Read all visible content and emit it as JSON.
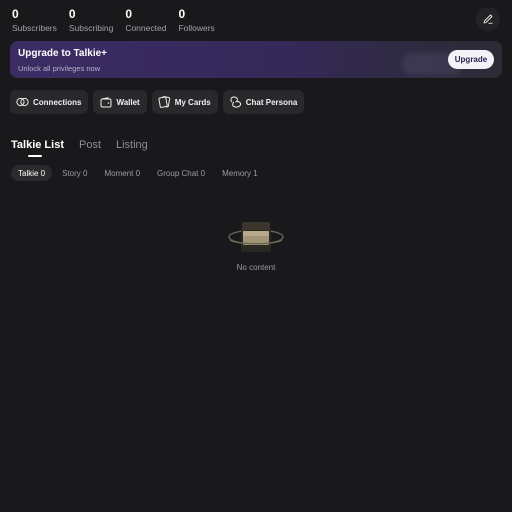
{
  "stats": [
    {
      "value": "0",
      "label": "Subscribers"
    },
    {
      "value": "0",
      "label": "Subscribing"
    },
    {
      "value": "0",
      "label": "Connected"
    },
    {
      "value": "0",
      "label": "Followers"
    }
  ],
  "banner": {
    "title": "Upgrade to Talkie+",
    "subtitle": "Unlock all privileges now",
    "button": "Upgrade"
  },
  "quick_actions": [
    {
      "label": "Connections",
      "icon": "connections-icon"
    },
    {
      "label": "Wallet",
      "icon": "wallet-icon"
    },
    {
      "label": "My Cards",
      "icon": "cards-icon"
    },
    {
      "label": "Chat Persona",
      "icon": "persona-icon"
    }
  ],
  "tabs": [
    {
      "label": "Talkie List",
      "active": true
    },
    {
      "label": "Post",
      "active": false
    },
    {
      "label": "Listing",
      "active": false
    }
  ],
  "subtabs": [
    {
      "label": "Talkie 0",
      "active": true
    },
    {
      "label": "Story 0",
      "active": false
    },
    {
      "label": "Moment 0",
      "active": false
    },
    {
      "label": "Group Chat 0",
      "active": false
    },
    {
      "label": "Memory 1",
      "active": false
    }
  ],
  "empty_state": {
    "message": "No content",
    "icon": "empty-box-icon"
  },
  "colors": {
    "background": "#19191b",
    "accent": "#3b2c63",
    "chip": "#29292c"
  }
}
